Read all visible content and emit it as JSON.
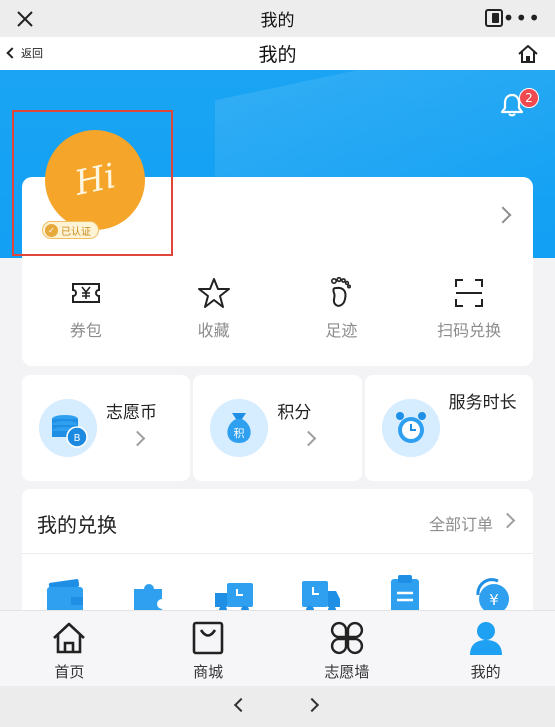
{
  "window": {
    "title": "我的"
  },
  "navbar": {
    "back_label": "返回",
    "title": "我的"
  },
  "notifications": {
    "badge_count": "2"
  },
  "profile": {
    "avatar_text": "Hi",
    "verified_label": "已认证"
  },
  "quick_links": [
    {
      "label": "券包",
      "icon": "ticket-icon"
    },
    {
      "label": "收藏",
      "icon": "star-icon"
    },
    {
      "label": "足迹",
      "icon": "footprint-icon"
    },
    {
      "label": "扫码兑换",
      "icon": "scan-icon"
    }
  ],
  "stats": [
    {
      "label": "志愿币",
      "icon": "coin-icon"
    },
    {
      "label": "积分",
      "icon": "money-bag-icon"
    },
    {
      "label": "服务时长",
      "icon": "alarm-clock-icon"
    }
  ],
  "exchange": {
    "title": "我的兑换",
    "view_all": "全部订单",
    "icons": [
      "wallet-icon",
      "puzzle-icon",
      "delivery-truck-icon",
      "shipping-truck-icon",
      "clipboard-icon",
      "refund-icon"
    ]
  },
  "tabbar": [
    {
      "label": "首页",
      "icon": "home-icon"
    },
    {
      "label": "商城",
      "icon": "shopping-bag-icon"
    },
    {
      "label": "志愿墙",
      "icon": "grid-icon"
    },
    {
      "label": "我的",
      "icon": "user-icon",
      "active": true
    }
  ],
  "colors": {
    "primary_blue": "#12a0f4",
    "avatar_orange": "#f5a52a",
    "badge_red": "#f0494f",
    "highlight_red": "#e0453a"
  }
}
